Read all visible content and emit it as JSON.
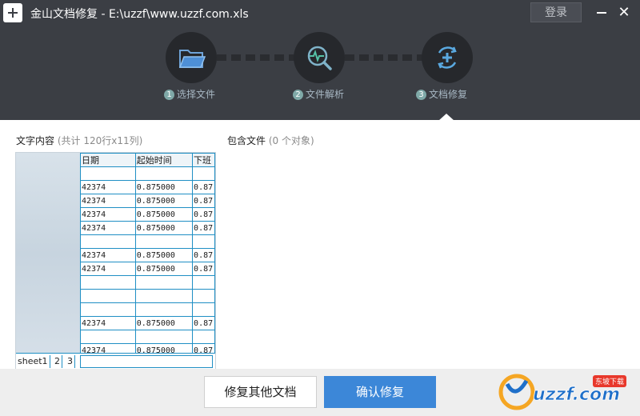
{
  "window": {
    "title": "金山文档修复 - E:\\uzzf\\www.uzzf.com.xls",
    "login_label": "登录",
    "minimize_icon": "minimize-icon",
    "close_glyph": "✕"
  },
  "steps": [
    {
      "num": "1",
      "label": "选择文件",
      "icon": "folder-icon"
    },
    {
      "num": "2",
      "label": "文件解析",
      "icon": "magnifier-pulse-icon"
    },
    {
      "num": "3",
      "label": "文档修复",
      "icon": "refresh-plus-icon"
    }
  ],
  "left_panel": {
    "title": "文字内容",
    "sub": "(共计 120行x11列)"
  },
  "right_panel": {
    "title": "包含文件",
    "sub": "(0 个对象)"
  },
  "sheet": {
    "headers": [
      "日期",
      "起始时间",
      "下班"
    ],
    "rows": [
      [
        "",
        "",
        ""
      ],
      [
        "42374",
        "0.875000",
        "0.87"
      ],
      [
        "42374",
        "0.875000",
        "0.87"
      ],
      [
        "42374",
        "0.875000",
        "0.87"
      ],
      [
        "42374",
        "0.875000",
        "0.87"
      ],
      [
        "",
        "",
        ""
      ],
      [
        "42374",
        "0.875000",
        "0.87"
      ],
      [
        "42374",
        "0.875000",
        "0.87"
      ],
      [
        "",
        "",
        ""
      ],
      [
        "",
        "",
        ""
      ],
      [
        "",
        "",
        ""
      ],
      [
        "42374",
        "0.875000",
        "0.87"
      ],
      [
        "",
        "",
        ""
      ],
      [
        "42374",
        "0.875000",
        "0.87"
      ]
    ],
    "tabs": [
      "sheet1",
      "2",
      "3"
    ]
  },
  "buttons": {
    "repair_other": "修复其他文档",
    "confirm": "确认修复"
  },
  "watermark": {
    "text": "uzzf.com",
    "badge": "东坡下载"
  },
  "colors": {
    "titlebar": "#3b3e44",
    "accent": "#3c87d8",
    "step_num": "#7fa9a8",
    "grid": "#1f8fc4"
  }
}
